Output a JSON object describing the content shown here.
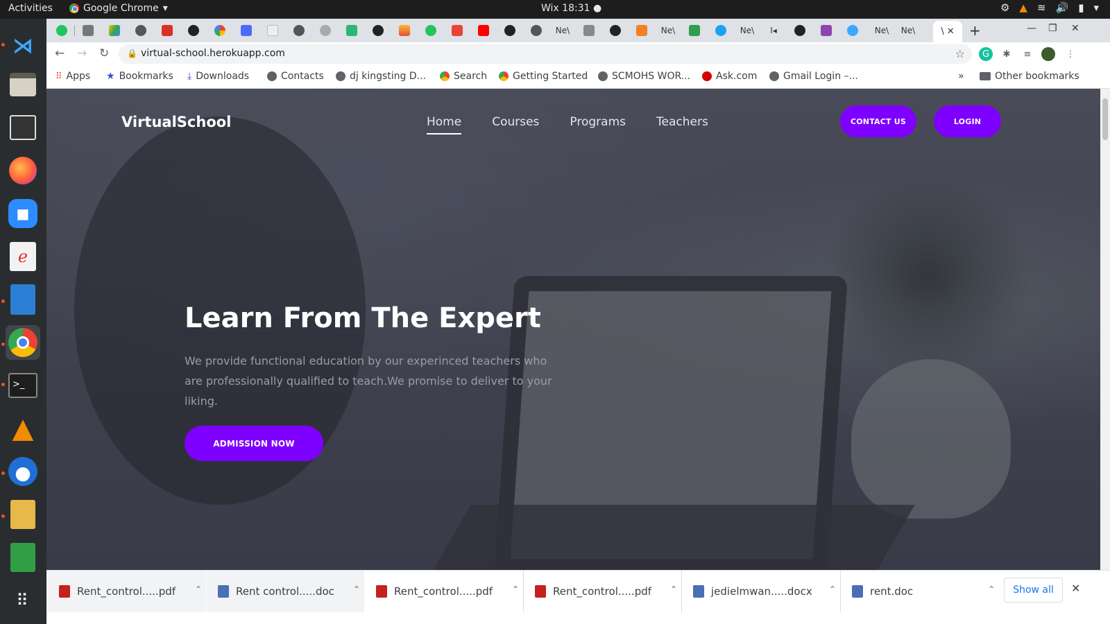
{
  "os": {
    "activities": "Activities",
    "app_name": "Google Chrome",
    "clock": "Wix 18:31 ●"
  },
  "browser": {
    "tabs": [
      "Ne\\",
      "Ne\\",
      "Ne\\",
      "I",
      "Ne\\",
      "Ne\\",
      "\\"
    ],
    "url": "virtual-school.herokuapp.com",
    "bookmarks": [
      "Apps",
      "Bookmarks",
      "Downloads",
      "Contacts",
      "dj kingsting D...",
      "Search",
      "Getting Started",
      "SCMOHS WOR...",
      "Ask.com",
      "Gmail Login –..."
    ],
    "bookmarks_more": "»",
    "other_bookmarks": "Other bookmarks"
  },
  "site": {
    "logo": "VirtualSchool",
    "nav": [
      "Home",
      "Courses",
      "Programs",
      "Teachers"
    ],
    "contact_label": "CONTACT US",
    "login_label": "LOGIN",
    "hero_title": "Learn From The Expert",
    "hero_text": "We provide functional education by our experinced teachers who are professionally qualified to teach.We promise to deliver to your liking.",
    "admission_label": "ADMISSION NOW",
    "accent": "#7e00ff"
  },
  "downloads": {
    "items": [
      "Rent_control.....pdf",
      "Rent control.....doc",
      "Rent_control.....pdf",
      "Rent_control.....pdf",
      "jedielmwan.....docx",
      "rent.doc"
    ],
    "show_all": "Show all"
  }
}
